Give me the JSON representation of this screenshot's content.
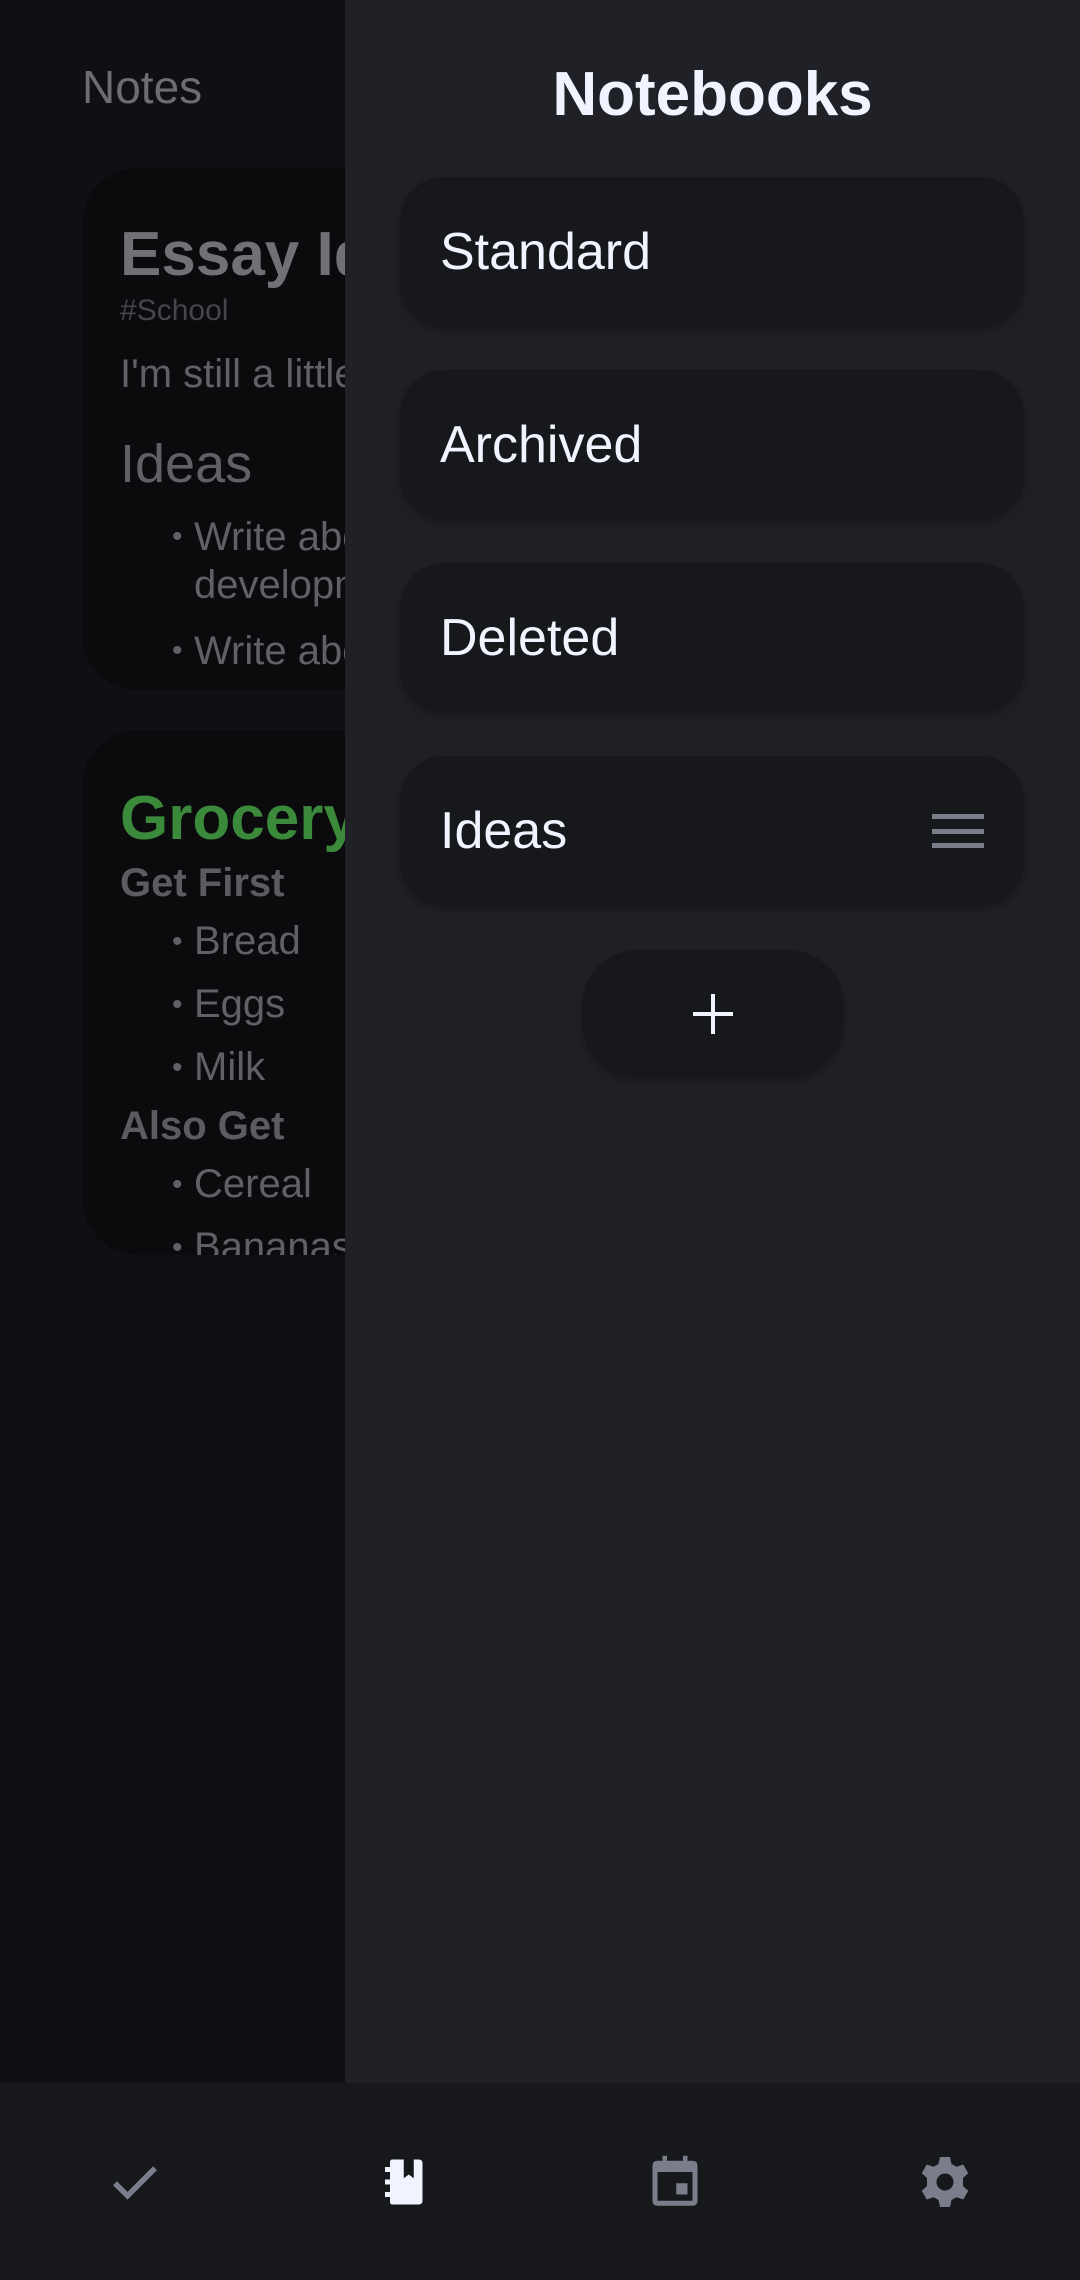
{
  "notes": {
    "title": "Notes",
    "essay": {
      "title": "Essay Ideas",
      "tag": "#School",
      "body": "I'm still a little",
      "heading": "Ideas",
      "bullets": [
        "Write about",
        "development",
        "Write about"
      ]
    },
    "grocery": {
      "title": "Grocery List",
      "sections": [
        {
          "heading": "Get First",
          "items": [
            "Bread",
            "Eggs",
            "Milk"
          ]
        },
        {
          "heading": "Also Get",
          "items": [
            "Cereal",
            "Bananas"
          ]
        }
      ]
    }
  },
  "drawer": {
    "title": "Notebooks",
    "notebooks": [
      {
        "label": "Standard",
        "reorderable": false
      },
      {
        "label": "Archived",
        "reorderable": false
      },
      {
        "label": "Deleted",
        "reorderable": false
      },
      {
        "label": "Ideas",
        "reorderable": true
      }
    ],
    "add_button_icon": "plus-icon"
  },
  "bottom_nav": {
    "items": [
      {
        "icon": "check-icon",
        "active": false
      },
      {
        "icon": "notebook-icon",
        "active": true
      },
      {
        "icon": "calendar-icon",
        "active": false
      },
      {
        "icon": "gear-icon",
        "active": false
      }
    ]
  },
  "colors": {
    "active_icon": "#f0f4ff",
    "inactive_icon": "#7a7d8a",
    "grocery_title": "#3b8a3b",
    "drawer_bg": "#1f2126",
    "card_bg": "#17181c"
  }
}
